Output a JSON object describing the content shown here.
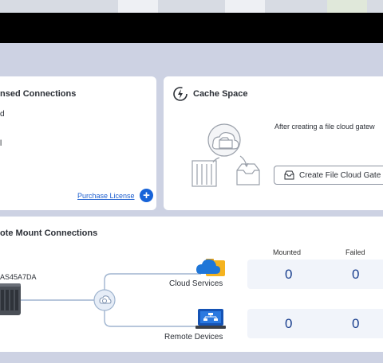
{
  "left_card": {
    "title": "nsed Connections",
    "line1": "d",
    "line2": "l",
    "purchase_link": "Purchase License",
    "add_glyph": "+"
  },
  "cache_card": {
    "title": "Cache Space",
    "description": "After creating a file cloud gatew",
    "button_label": "Create File Cloud Gate"
  },
  "mount_card": {
    "title": "ote Mount Connections",
    "device_name": "AS45A7DA",
    "columns": [
      "Mounted",
      "Failed"
    ],
    "rows": [
      {
        "label": "Cloud Services",
        "mounted": "0",
        "failed": "0",
        "icon": "cloud-folder-icon"
      },
      {
        "label": "Remote Devices",
        "mounted": "0",
        "failed": "0",
        "icon": "laptop-network-icon"
      }
    ]
  },
  "colors": {
    "accent": "#1763d8",
    "link": "#1d5fd0",
    "number": "#1a3f8e",
    "background": "#cdd2e3"
  }
}
